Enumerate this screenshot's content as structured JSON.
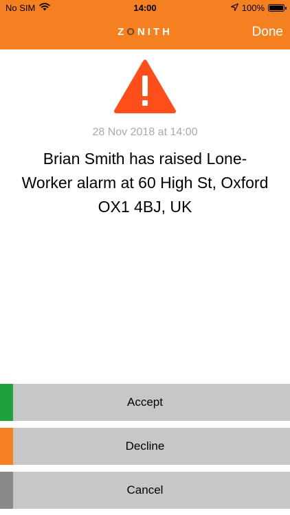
{
  "status_bar": {
    "carrier": "No SIM",
    "time": "14:00",
    "battery": "100%",
    "icons": [
      "wifi-icon",
      "location-arrow-icon",
      "battery-icon"
    ]
  },
  "nav": {
    "brand_pre": "Z",
    "brand_accent": "O",
    "brand_post": "NITH",
    "done_label": "Done"
  },
  "alert": {
    "icon": "warning-icon",
    "timestamp": "28 Nov 2018 at 14:00",
    "message": "Brian Smith has raised Lone-Worker alarm at 60 High St, Oxford OX1 4BJ, UK"
  },
  "actions": {
    "accept_label": "Accept",
    "decline_label": "Decline",
    "cancel_label": "Cancel"
  },
  "colors": {
    "header": "#f5801f",
    "warning": "#ff4e1a",
    "accept": "#1fa23c",
    "decline": "#f5801f",
    "cancel": "#8a8a8a",
    "button_bg": "#c8c7c7"
  }
}
